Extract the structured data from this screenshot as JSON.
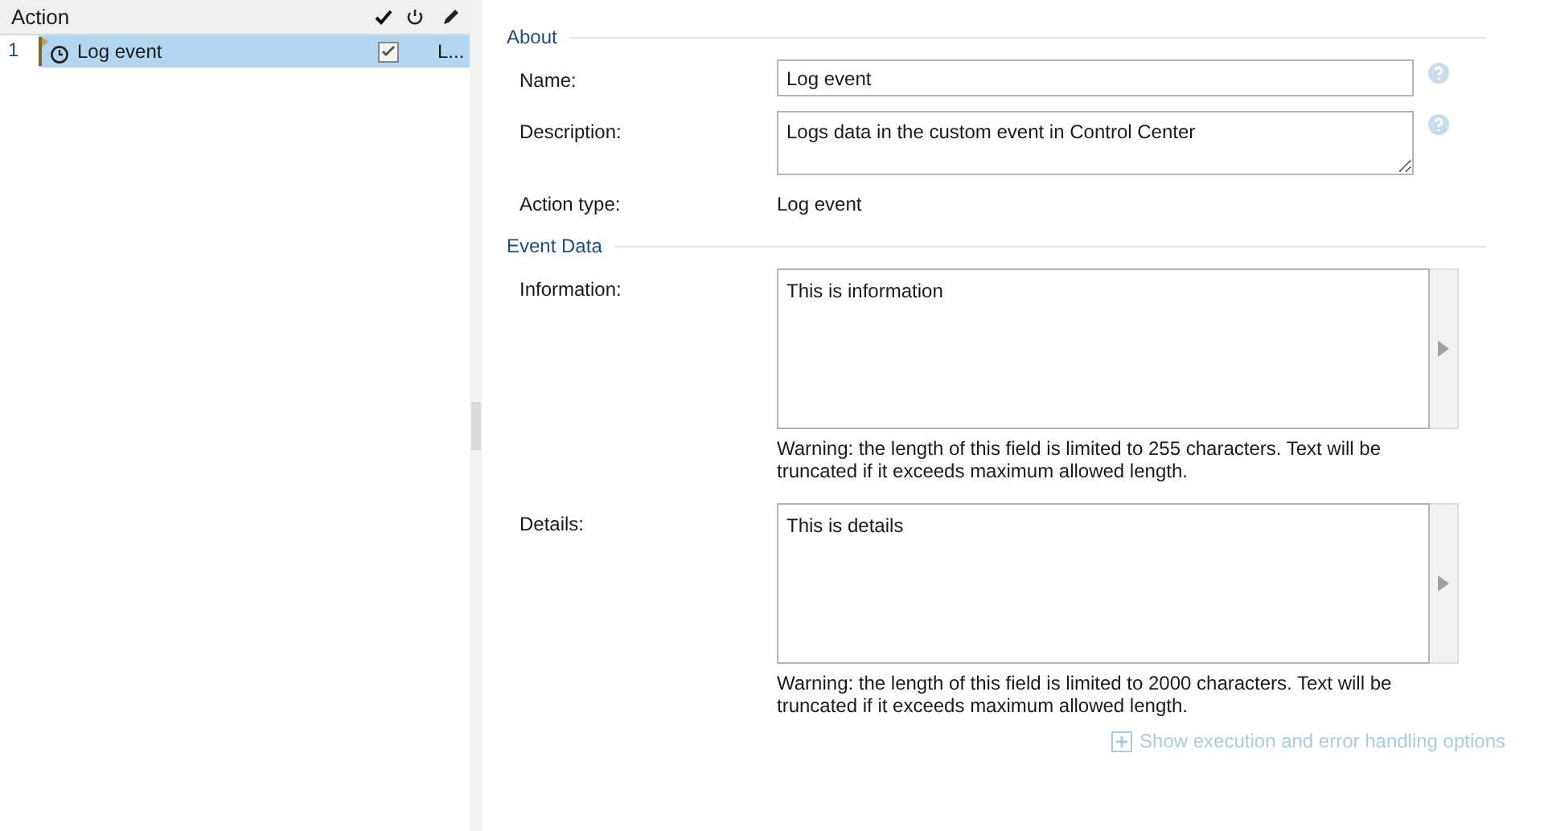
{
  "action_list": {
    "columns": [
      "Action"
    ],
    "rows": [
      {
        "number": "1",
        "name": "Log event",
        "selected": true,
        "enabled": true,
        "column_4": "L..."
      }
    ]
  },
  "about": {
    "title": "About",
    "name_label": "Name:",
    "name_value": "Log event",
    "description_label": "Description:",
    "description_value": "Logs data in the custom event in Control Center",
    "action_type_label": "Action type:",
    "action_type_value": "Log event"
  },
  "event_data": {
    "title": "Event Data",
    "fields": [
      {
        "label": "Information:",
        "value": "This is information",
        "warning": "Warning: the length of this field is limited to 255 characters. Text will be truncated if it exceeds maximum allowed length."
      },
      {
        "label": "Details:",
        "value": "This is details",
        "warning": "Warning: the length of this field is limited to 2000 characters. Text will be truncated if it exceeds maximum allowed length."
      }
    ]
  },
  "options_link": "Show execution and error handling options"
}
